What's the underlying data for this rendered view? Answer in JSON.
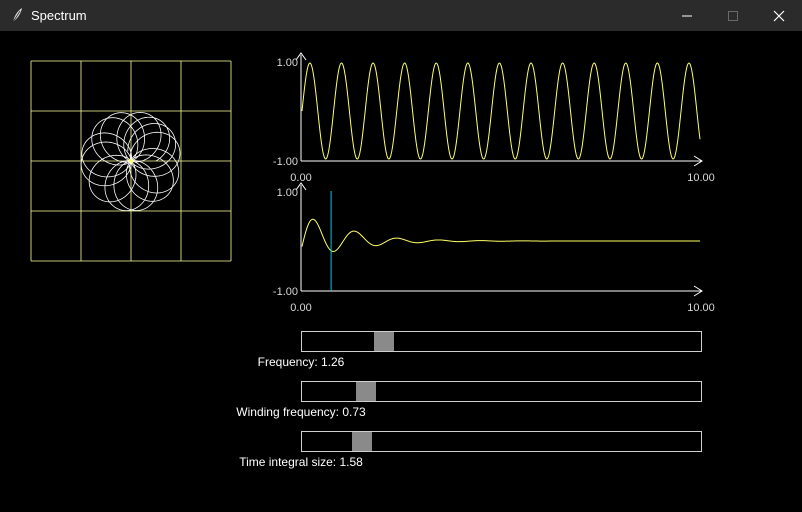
{
  "window": {
    "title": "Spectrum",
    "buttons": [
      "minimize",
      "maximize",
      "close"
    ]
  },
  "winding_plot": {
    "grid": true
  },
  "signal_plot": {
    "y_max": "1.00",
    "y_min": "-1.00",
    "x_min": "0.00",
    "x_max": "10.00"
  },
  "spectrum_plot": {
    "y_max": "1.00",
    "y_min": "-1.00",
    "x_min": "0.00",
    "x_max": "10.00"
  },
  "sliders": [
    {
      "label": "Frequency: 1.26",
      "value": 1.26,
      "fraction": 0.12
    },
    {
      "label": "Winding frequency: 0.73",
      "value": 0.73,
      "fraction": 0.07
    },
    {
      "label": "Time integral size: 1.58",
      "value": 1.58,
      "fraction": 0.06
    }
  ],
  "colors": {
    "background": "#000000",
    "titlebar": "#2b2b2b",
    "curve": "#ffff66",
    "grid": "#ffff99",
    "winding": "#ffffff",
    "marker": "#00c8d8",
    "axis": "#ffffff",
    "thumb": "#8a8a8a"
  }
}
